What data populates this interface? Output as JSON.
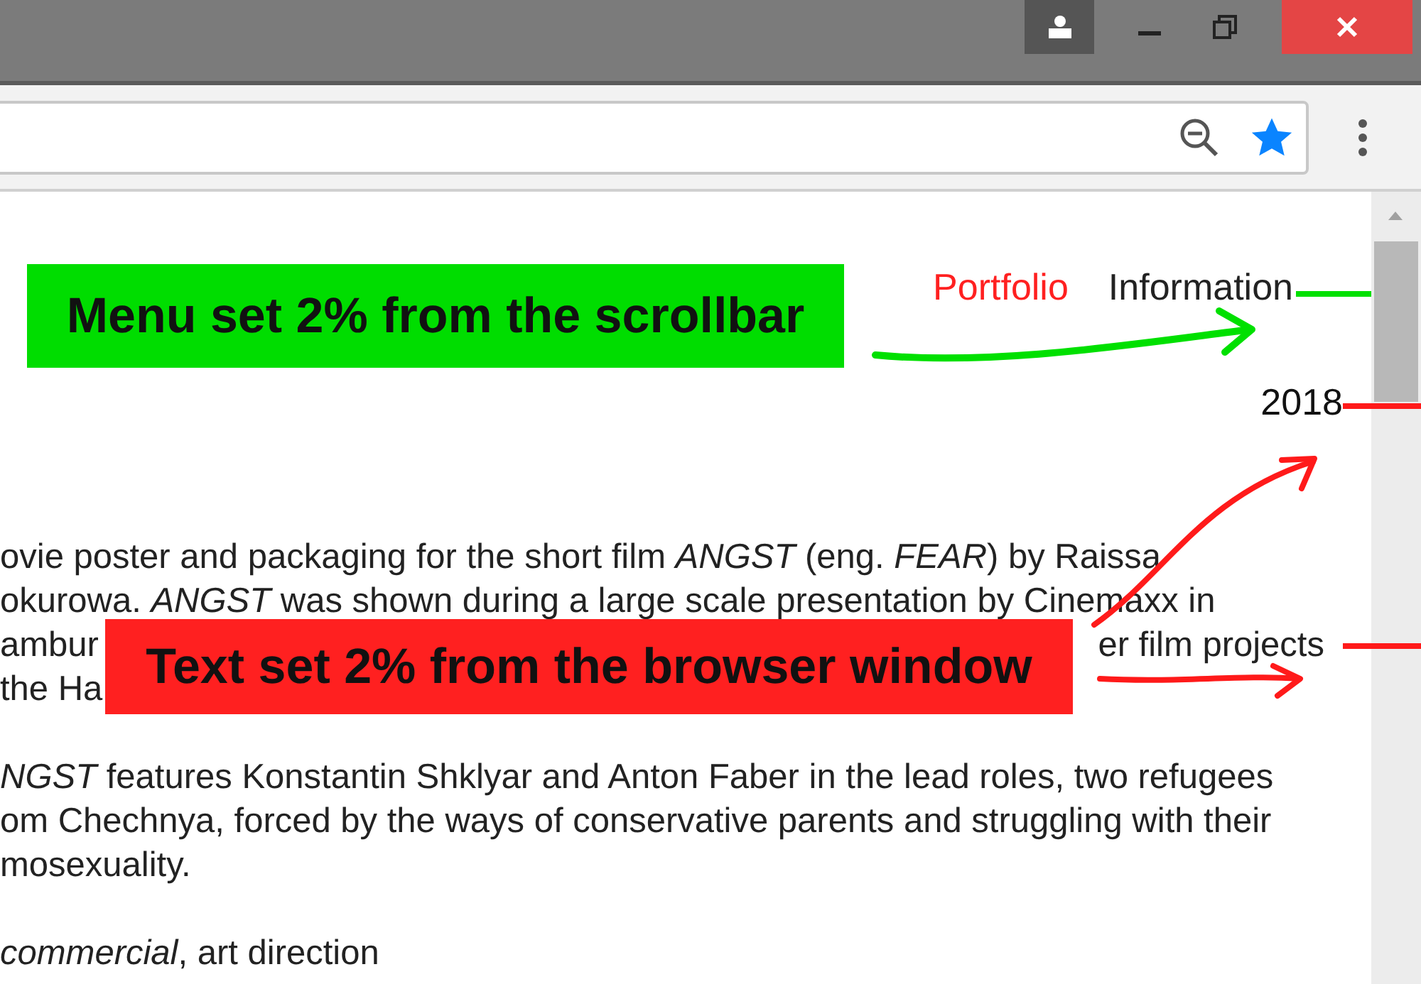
{
  "nav": [
    {
      "label": "Portfolio",
      "selected": true
    },
    {
      "label": "Information",
      "selected": false
    }
  ],
  "year": "2018",
  "paragraphs": [
    {
      "lines": [
        {
          "text": "ovie poster and packaging for the short film *ANGST* (eng. *FEAR*) by Raissa"
        },
        {
          "text": "okurowa. *ANGST* was shown during a large scale presentation by Cinemaxx in"
        },
        {
          "text": "ambur",
          "after": "er film projects"
        },
        {
          "text": "the Ha"
        }
      ]
    },
    {
      "lines": [
        {
          "text": "*NGST* features Konstantin Shklyar and Anton Faber in the lead roles, two refugees"
        },
        {
          "text": "om Chechnya, forced by the ways of conservative parents and struggling with their"
        },
        {
          "text": "mosexuality."
        }
      ]
    },
    {
      "lines": [
        {
          "text": "*commercial*, art direction"
        }
      ]
    }
  ],
  "annotations": [
    {
      "text": "Menu set 2% from the scrollbar",
      "color": "#00dd00"
    },
    {
      "text": "Text set 2% from the browser window",
      "color": "#ff2020"
    }
  ]
}
